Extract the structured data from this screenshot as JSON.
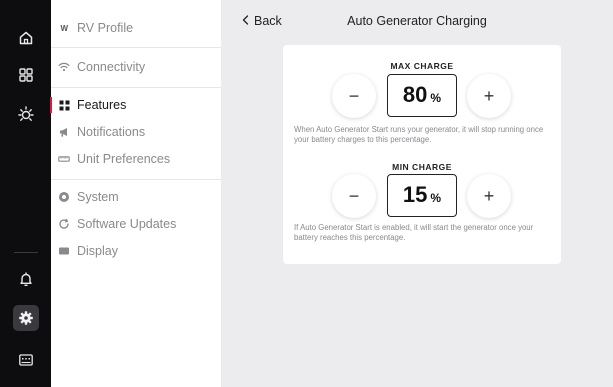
{
  "rail": {
    "icons": [
      "home-icon",
      "dashboard-grid-icon",
      "sun-icon",
      "bell-icon",
      "gear-icon",
      "keyboard-icon"
    ],
    "active": "gear-icon"
  },
  "sidebar": {
    "items": [
      {
        "label": "RV Profile",
        "icon": "brand-logo-icon"
      },
      {
        "label": "Connectivity",
        "icon": "wifi-icon"
      },
      {
        "label": "Features",
        "icon": "grid-icon",
        "active": true
      },
      {
        "label": "Notifications",
        "icon": "megaphone-icon"
      },
      {
        "label": "Unit Preferences",
        "icon": "ruler-icon"
      },
      {
        "label": "System",
        "icon": "system-icon"
      },
      {
        "label": "Software Updates",
        "icon": "refresh-icon"
      },
      {
        "label": "Display",
        "icon": "display-icon"
      }
    ],
    "logo_text": "W"
  },
  "header": {
    "back_label": "Back",
    "title": "Auto Generator Charging"
  },
  "max_charge": {
    "label": "MAX CHARGE",
    "value": "80",
    "unit": "%",
    "decrement": "−",
    "increment": "+",
    "hint": "When Auto Generator Start runs your generator, it will stop running once your battery charges to this percentage."
  },
  "min_charge": {
    "label": "MIN CHARGE",
    "value": "15",
    "unit": "%",
    "decrement": "−",
    "increment": "+",
    "hint": "If Auto Generator Start is enabled, it will start the generator once your battery reaches this percentage."
  },
  "colors": {
    "accent": "#e0193a",
    "rail_bg": "#0d0d0f",
    "main_bg": "#ececef"
  }
}
